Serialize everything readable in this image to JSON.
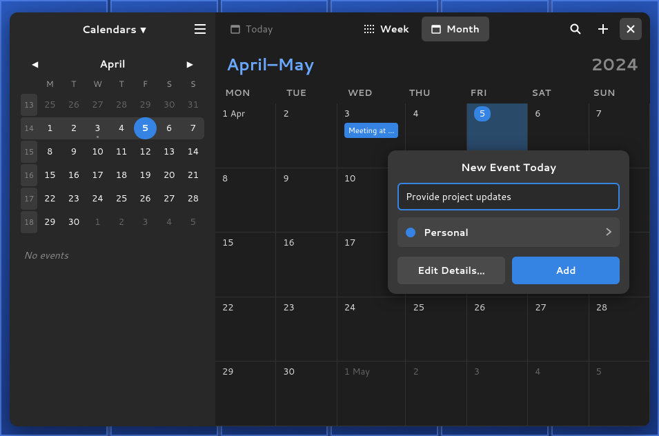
{
  "sidebar": {
    "calendars_label": "Calendars",
    "month_label": "April",
    "day_headers": [
      "M",
      "T",
      "W",
      "T",
      "F",
      "S",
      "S"
    ],
    "weeks": [
      {
        "num": "13",
        "days": [
          {
            "n": "25",
            "dim": true
          },
          {
            "n": "26",
            "dim": true
          },
          {
            "n": "27",
            "dim": true
          },
          {
            "n": "28",
            "dim": true
          },
          {
            "n": "29",
            "dim": true
          },
          {
            "n": "30",
            "dim": true
          },
          {
            "n": "31",
            "dim": true
          }
        ]
      },
      {
        "num": "14",
        "current": true,
        "days": [
          {
            "n": "1"
          },
          {
            "n": "2"
          },
          {
            "n": "3",
            "event": true
          },
          {
            "n": "4"
          },
          {
            "n": "5",
            "selected": true
          },
          {
            "n": "6"
          },
          {
            "n": "7"
          }
        ]
      },
      {
        "num": "15",
        "days": [
          {
            "n": "8"
          },
          {
            "n": "9"
          },
          {
            "n": "10"
          },
          {
            "n": "11"
          },
          {
            "n": "12"
          },
          {
            "n": "13"
          },
          {
            "n": "14"
          }
        ]
      },
      {
        "num": "16",
        "days": [
          {
            "n": "15"
          },
          {
            "n": "16"
          },
          {
            "n": "17"
          },
          {
            "n": "18"
          },
          {
            "n": "19"
          },
          {
            "n": "20"
          },
          {
            "n": "21"
          }
        ]
      },
      {
        "num": "17",
        "days": [
          {
            "n": "22"
          },
          {
            "n": "23"
          },
          {
            "n": "24"
          },
          {
            "n": "25"
          },
          {
            "n": "26"
          },
          {
            "n": "27"
          },
          {
            "n": "28"
          }
        ]
      },
      {
        "num": "18",
        "days": [
          {
            "n": "29"
          },
          {
            "n": "30"
          },
          {
            "n": "1",
            "dim": true
          },
          {
            "n": "2",
            "dim": true
          },
          {
            "n": "3",
            "dim": true
          },
          {
            "n": "4",
            "dim": true
          },
          {
            "n": "5",
            "dim": true
          }
        ]
      }
    ],
    "no_events": "No events"
  },
  "main": {
    "today_label": "Today",
    "week_label": "Week",
    "month_label": "Month",
    "month_title": "April–May",
    "year": "2024",
    "day_headers": [
      "MON",
      "TUE",
      "WED",
      "THU",
      "FRI",
      "SAT",
      "SUN"
    ],
    "grid": [
      [
        {
          "n": "1",
          "suffix": "Apr"
        },
        {
          "n": "2"
        },
        {
          "n": "3",
          "event": "Meeting at …"
        },
        {
          "n": "4"
        },
        {
          "n": "5",
          "selected": true
        },
        {
          "n": "6"
        },
        {
          "n": "7"
        }
      ],
      [
        {
          "n": "8"
        },
        {
          "n": "9"
        },
        {
          "n": "10"
        },
        {
          "n": ""
        },
        {
          "n": ""
        },
        {
          "n": ""
        },
        {
          "n": ""
        }
      ],
      [
        {
          "n": "15"
        },
        {
          "n": "16"
        },
        {
          "n": "17"
        },
        {
          "n": ""
        },
        {
          "n": ""
        },
        {
          "n": ""
        },
        {
          "n": ""
        }
      ],
      [
        {
          "n": "22"
        },
        {
          "n": "23"
        },
        {
          "n": "24"
        },
        {
          "n": "25"
        },
        {
          "n": "26"
        },
        {
          "n": "27"
        },
        {
          "n": "28"
        }
      ],
      [
        {
          "n": "29"
        },
        {
          "n": "30"
        },
        {
          "n": "1",
          "suffix": "May",
          "dim": true
        },
        {
          "n": "2",
          "dim": true
        },
        {
          "n": "3",
          "dim": true
        },
        {
          "n": "4",
          "dim": true
        },
        {
          "n": "5",
          "dim": true
        }
      ]
    ]
  },
  "popover": {
    "title": "New Event Today",
    "input_value": "Provide project updates",
    "calendar_name": "Personal",
    "edit_label": "Edit Details…",
    "add_label": "Add"
  }
}
